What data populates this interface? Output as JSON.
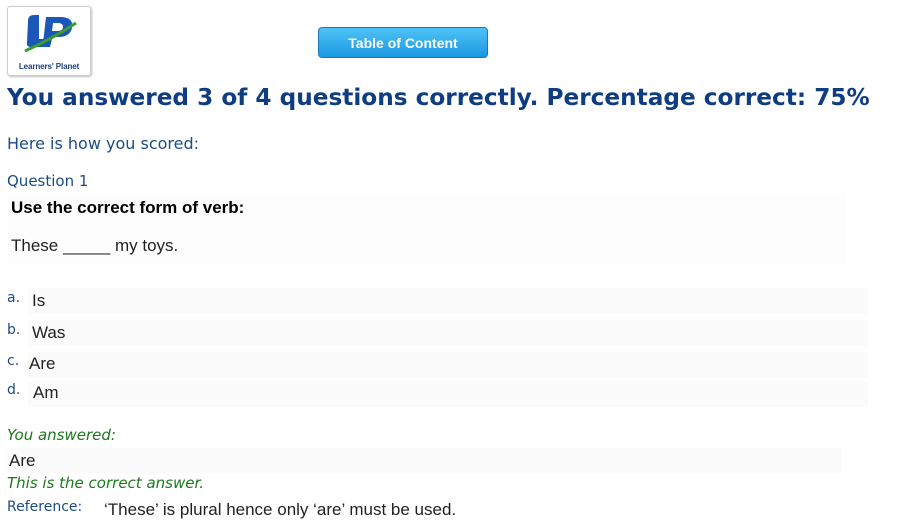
{
  "logo": {
    "text": "Learners' Planet",
    "colors": {
      "blue": "#1a57b8",
      "green": "#3d9c2e"
    }
  },
  "header": {
    "toc_button_label": "Table of Content"
  },
  "result": {
    "summary": "You answered 3 of 4 questions correctly. Percentage correct: 75%",
    "scored_label": "Here is how you scored:"
  },
  "question": {
    "number_label": "Question 1",
    "instruction": "Use the correct form of verb:",
    "sentence": "These _____ my toys.",
    "options": [
      {
        "letter": "a.",
        "text": "Is"
      },
      {
        "letter": "b.",
        "text": "Was"
      },
      {
        "letter": "c.",
        "text": "Are"
      },
      {
        "letter": "d.",
        "text": "Am"
      }
    ]
  },
  "feedback": {
    "you_answered_label": "You answered:",
    "answer": "Are",
    "correct_message": "This is the correct answer.",
    "reference_label": "Reference:",
    "reference_text": "‘These’ is plural hence only ‘are’ must be used."
  }
}
